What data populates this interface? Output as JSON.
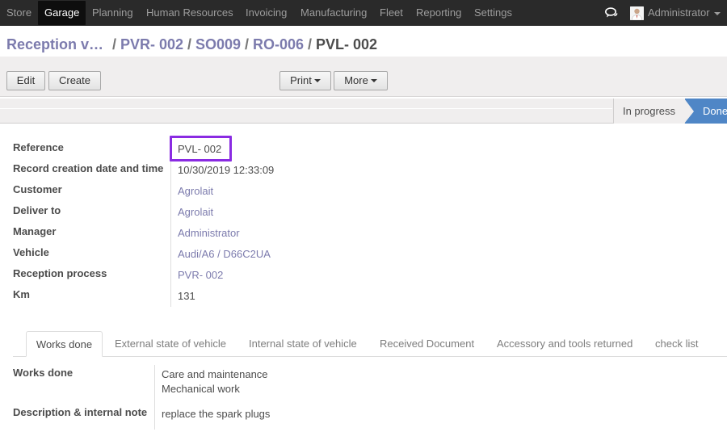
{
  "navbar": {
    "items": [
      "Store",
      "Garage",
      "Planning",
      "Human Resources",
      "Invoicing",
      "Manufacturing",
      "Fleet",
      "Reporting",
      "Settings"
    ],
    "active_index": 1,
    "user": "Administrator",
    "chat_icon": "chat-bubbles-icon",
    "avatar_icon": "user-avatar-icon"
  },
  "breadcrumb": {
    "items": [
      "Reception v…",
      "PVR- 002",
      "SO009",
      "RO-006"
    ],
    "separator": "/",
    "current": "PVL- 002"
  },
  "control_panel": {
    "edit_label": "Edit",
    "create_label": "Create",
    "print_label": "Print",
    "more_label": "More"
  },
  "status": {
    "stages": [
      "In progress",
      "Done"
    ],
    "active": "Done"
  },
  "form": {
    "reference_label": "Reference",
    "reference_value": "PVL- 002",
    "creation_label": "Record creation date and time",
    "creation_value": "10/30/2019 12:33:09",
    "customer_label": "Customer",
    "customer_value": "Agrolait",
    "deliver_label": "Deliver to",
    "deliver_value": "Agrolait",
    "manager_label": "Manager",
    "manager_value": "Administrator",
    "vehicle_label": "Vehicle",
    "vehicle_value": "Audi/A6 / D66C2UA",
    "reception_label": "Reception process",
    "reception_value": "PVR- 002",
    "km_label": "Km",
    "km_value": "131"
  },
  "tabs": {
    "items": [
      "Works done",
      "External state of vehicle",
      "Internal state of vehicle",
      "Received Document",
      "Accessory and tools returned",
      "check list"
    ],
    "active_index": 0
  },
  "works": {
    "works_done_label": "Works done",
    "works_done_lines": [
      "Care and maintenance",
      "Mechanical work"
    ],
    "description_label": "Description & internal note",
    "description_value": "replace the spark plugs"
  },
  "colors": {
    "navbar_bg": "#2a2a2a",
    "link": "#7c7bad",
    "highlight": "#8a2be2",
    "status_done": "#4f86c6"
  }
}
